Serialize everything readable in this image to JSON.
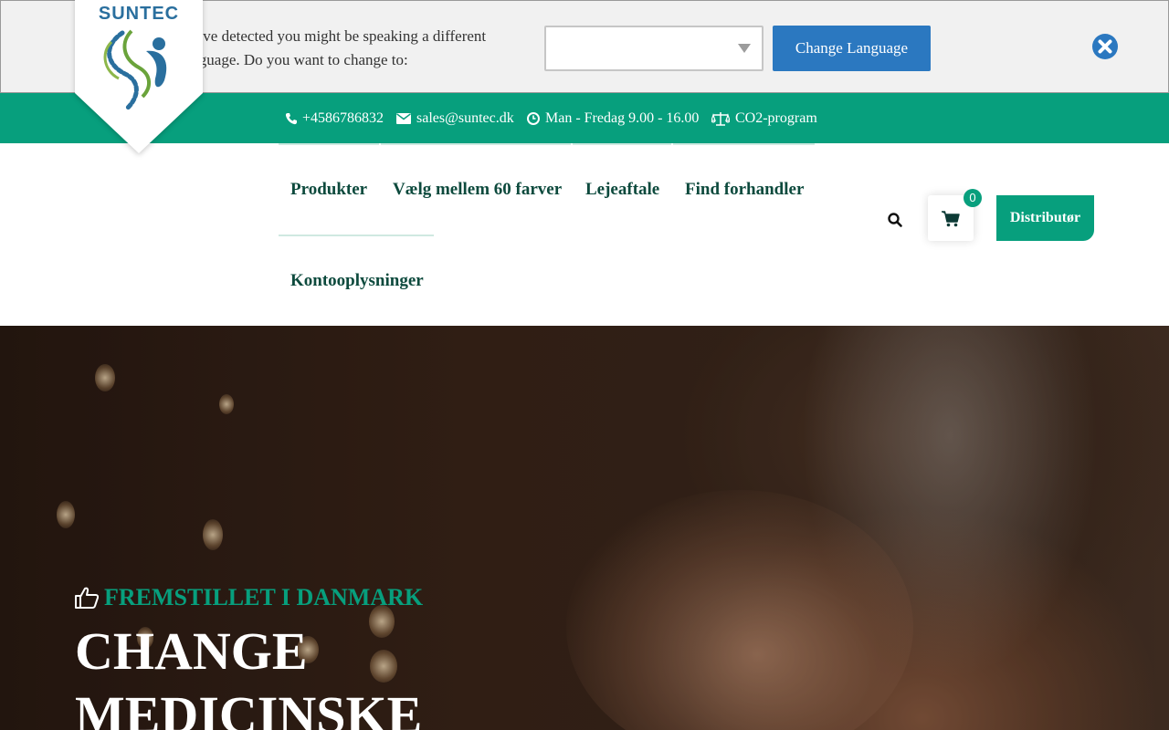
{
  "language_banner": {
    "message": "We've detected you might be speaking a different language. Do you want to change to:",
    "select_value": "",
    "button_label": "Change Language",
    "close_icon": "close-circle-icon"
  },
  "logo": {
    "text": "SUNTEC"
  },
  "info_bar": {
    "phone": "+4586786832",
    "email": "sales@suntec.dk",
    "hours": "Man - Fredag 9.00 - 16.00",
    "co2": "CO2-program"
  },
  "nav": {
    "items": [
      "Produkter",
      "Vælg mellem 60 farver",
      "Lejeaftale",
      "Find forhandler",
      "Kontooplysninger"
    ],
    "cart_count": "0",
    "distributor_label": "Distributør"
  },
  "hero": {
    "tag": "FREMSTILLET I DANMARK",
    "title": "CHANGE\nMEDICINSKE"
  },
  "colors": {
    "brand_green": "#079f7d",
    "button_blue": "#2b78c0",
    "nav_text": "#0d4a3d"
  }
}
